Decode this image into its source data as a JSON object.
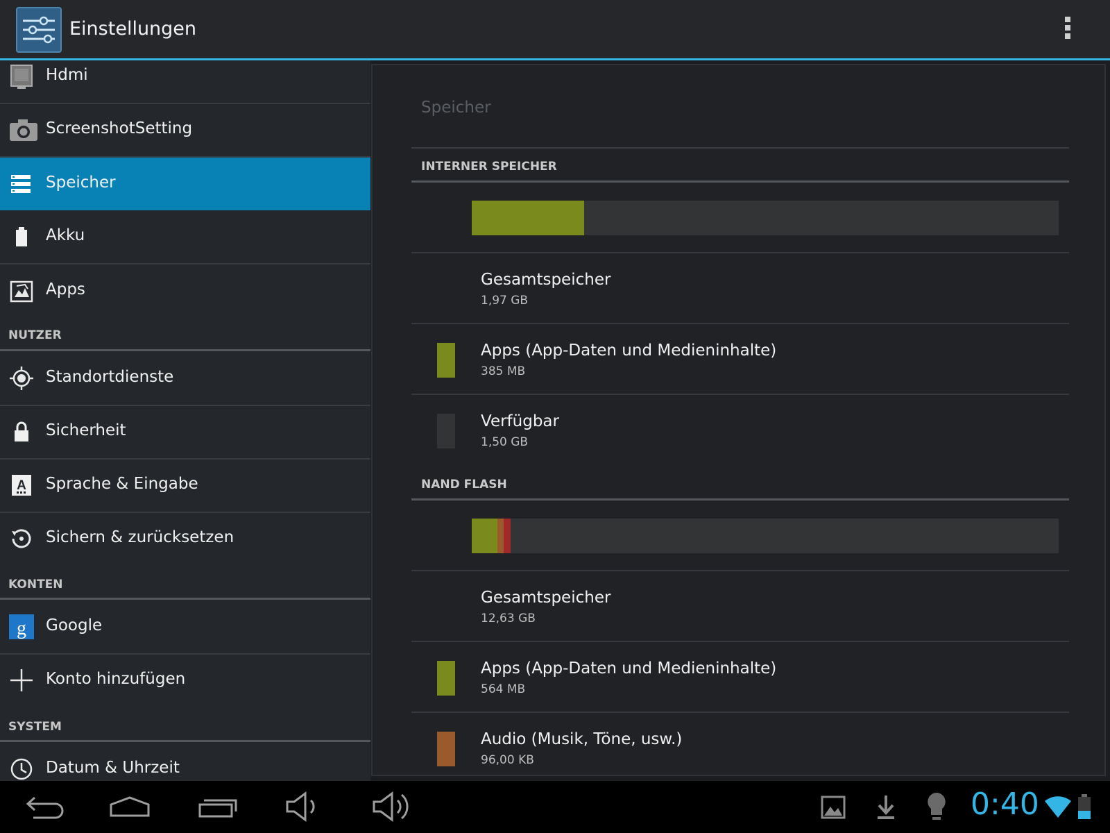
{
  "action_bar": {
    "title": "Einstellungen",
    "app_icon": "settings-sliders-icon",
    "overflow_icon": "overflow-menu-icon"
  },
  "sidebar": {
    "items": [
      {
        "label": "Hdmi",
        "icon": "hdmi-icon"
      },
      {
        "label": "ScreenshotSetting",
        "icon": "camera-icon"
      },
      {
        "label": "Speicher",
        "icon": "storage-icon",
        "selected": true
      },
      {
        "label": "Akku",
        "icon": "battery-icon"
      },
      {
        "label": "Apps",
        "icon": "apps-icon"
      },
      {
        "label": "Standortdienste",
        "icon": "location-icon"
      },
      {
        "label": "Sicherheit",
        "icon": "lock-icon"
      },
      {
        "label": "Sprache & Eingabe",
        "icon": "language-icon"
      },
      {
        "label": "Sichern & zurücksetzen",
        "icon": "backup-icon"
      },
      {
        "label": "Google",
        "icon": "google-icon"
      },
      {
        "label": "Konto hinzufügen",
        "icon": "add-icon"
      },
      {
        "label": "Datum & Uhrzeit",
        "icon": "clock-icon"
      }
    ],
    "headers": {
      "user": "NUTZER",
      "accounts": "KONTEN",
      "system": "SYSTEM"
    }
  },
  "detail": {
    "title": "Speicher",
    "internal": {
      "header": "INTERNER SPEICHER",
      "usage_segments": [
        {
          "name": "Apps",
          "fraction": 0.191,
          "color": "#7b8a1c"
        }
      ],
      "total": {
        "title": "Gesamtspeicher",
        "value": "1,97 GB"
      },
      "apps": {
        "title": "Apps (App-Daten und Medieninhalte)",
        "value": "385 MB",
        "color": "#7b8a1c"
      },
      "available": {
        "title": "Verfügbar",
        "value": "1,50 GB",
        "color": "#333436"
      }
    },
    "nand": {
      "header": "NAND FLASH",
      "usage_segments": [
        {
          "name": "Apps",
          "fraction": 0.044,
          "color": "#7b8a1c"
        },
        {
          "name": "Audio",
          "fraction": 0.01,
          "color": "#9b5a2c"
        },
        {
          "name": "Other",
          "fraction": 0.012,
          "color": "#a02a2a"
        }
      ],
      "total": {
        "title": "Gesamtspeicher",
        "value": "12,63 GB"
      },
      "apps": {
        "title": "Apps (App-Daten und Medieninhalte)",
        "value": "564 MB",
        "color": "#7b8a1c"
      },
      "audio": {
        "title": "Audio (Musik, Töne, usw.)",
        "value": "96,00 KB",
        "color": "#9b5a2c"
      }
    }
  },
  "nav_bar": {
    "buttons": [
      "back-icon",
      "home-icon",
      "recent-apps-icon",
      "volume-down-icon",
      "volume-up-icon"
    ],
    "status_icons": [
      "gallery-icon",
      "download-icon",
      "lightbulb-icon",
      "wifi-icon",
      "battery-status-icon"
    ],
    "clock": "0:40",
    "accent": "#33b5e5"
  }
}
